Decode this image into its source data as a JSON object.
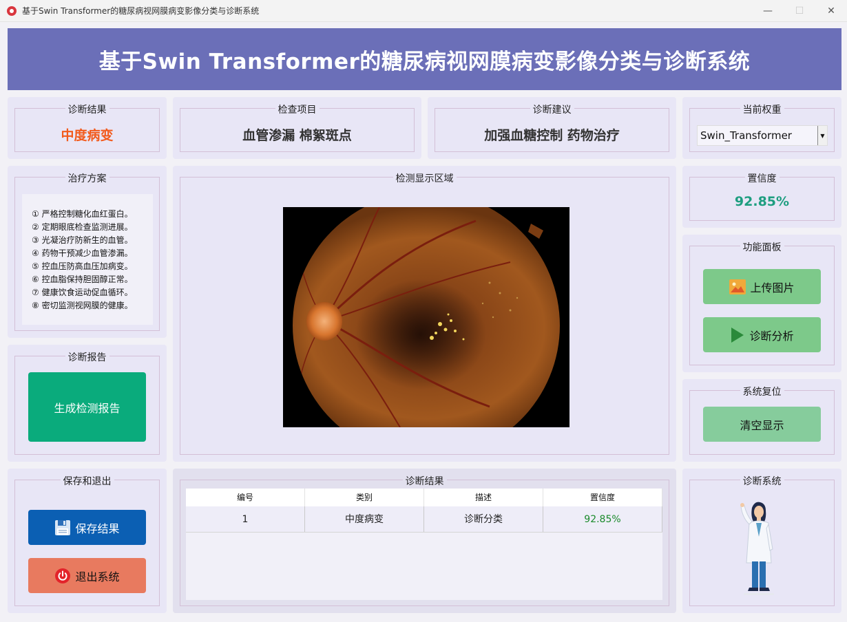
{
  "window": {
    "title": "基于Swin Transformer的糖尿病视网膜病变影像分类与诊断系统",
    "controls": {
      "minimize": "—",
      "maximize": "☐",
      "close": "✕"
    }
  },
  "header": {
    "title": "基于Swin Transformer的糖尿病视网膜病变影像分类与诊断系统"
  },
  "diagnosis_result": {
    "label": "诊断结果",
    "value": "中度病变"
  },
  "check_items": {
    "label": "检查项目",
    "value": "血管渗漏 棉絮斑点"
  },
  "advice": {
    "label": "诊断建议",
    "value": "加强血糖控制 药物治疗"
  },
  "weights": {
    "label": "当前权重",
    "selected": "Swin_Transformer"
  },
  "treatment": {
    "label": "治疗方案",
    "items": [
      "① 严格控制糖化血红蛋白。",
      "② 定期眼底检查监测进展。",
      "③ 光凝治疗防新生的血管。",
      "④ 药物干预减少血管渗漏。",
      "⑤ 控血压防高血压加病变。",
      "⑥ 控血脂保持胆固醇正常。",
      "⑦ 健康饮食运动促血循环。",
      "⑧ 密切监测视网膜的健康。"
    ]
  },
  "display_area": {
    "label": "检测显示区域"
  },
  "confidence": {
    "label": "置信度",
    "value": "92.85%"
  },
  "function_panel": {
    "label": "功能面板",
    "upload_label": "上传图片",
    "analyze_label": "诊断分析"
  },
  "reset": {
    "label": "系统复位",
    "clear_label": "清空显示"
  },
  "report": {
    "label": "诊断报告",
    "generate_label": "生成检测报告"
  },
  "save_exit": {
    "label": "保存和退出",
    "save_label": "保存结果",
    "exit_label": "退出系统"
  },
  "results_table": {
    "label": "诊断结果",
    "columns": [
      "编号",
      "类别",
      "描述",
      "置信度"
    ],
    "rows": [
      {
        "id": "1",
        "category": "中度病变",
        "description": "诊断分类",
        "confidence": "92.85%"
      }
    ]
  },
  "system": {
    "label": "诊断系统"
  },
  "colors": {
    "header_bg": "#6b6fb8",
    "panel_bg": "#e8e6f6",
    "result_orange": "#f25a1c",
    "confidence_green": "#1e9e80",
    "button_green": "#7dc98a",
    "button_teal": "#0aab7c",
    "button_blue": "#0b5fb3",
    "button_salmon": "#e87a5f"
  }
}
